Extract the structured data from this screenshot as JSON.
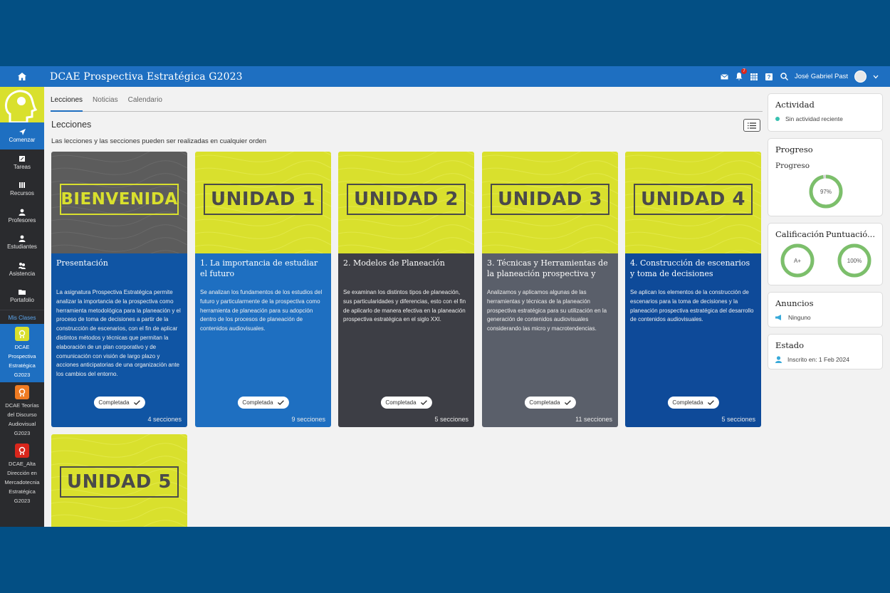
{
  "header": {
    "course_title": "DCAE Prospectiva Estratégica G2023",
    "user_name": "José Gabriel Past",
    "notification_count": "7"
  },
  "sidebar": {
    "items": [
      {
        "label": "Comenzar",
        "icon": "arrow-icon",
        "active": true
      },
      {
        "label": "Tareas",
        "icon": "edit-icon",
        "active": false
      },
      {
        "label": "Recursos",
        "icon": "library-icon",
        "active": false
      },
      {
        "label": "Profesores",
        "icon": "user-icon",
        "active": false
      },
      {
        "label": "Estudiantes",
        "icon": "user-icon",
        "active": false
      },
      {
        "label": "Asistencia",
        "icon": "group-icon",
        "active": false
      },
      {
        "label": "Portafolio",
        "icon": "folder-icon",
        "active": false
      }
    ],
    "section_label": "Mis Clases",
    "courses": [
      {
        "label": "DCAE Prospectiva Estratégica G2023",
        "color": "#d9e02d",
        "active": true
      },
      {
        "label": "DCAE Teorías del Discurso Audiovisual G2023",
        "color": "#ef7b22",
        "active": false
      },
      {
        "label": "DCAE_Alta Dirección en Mercadotecnia Estratégica G2023",
        "color": "#d9261c",
        "active": false
      }
    ]
  },
  "tabs": [
    {
      "label": "Lecciones",
      "active": true
    },
    {
      "label": "Noticias",
      "active": false
    },
    {
      "label": "Calendario",
      "active": false
    }
  ],
  "lessons": {
    "title": "Lecciones",
    "subtitle": "Las lecciones y las secciones pueden ser realizadas en cualquier orden",
    "cards": [
      {
        "banner": "BIENVENIDA",
        "title": "Presentación",
        "desc": "La asignatura Prospectiva Estratégica permite analizar la importancia de la prospectiva como herramienta metodológica para la planeación y el proceso de toma de decisiones a partir de la construcción de escenarios, con el fin de aplicar distintos métodos y técnicas que permitan la elaboración de un plan corporativo y de comunicación con visión de largo plazo y acciones anticipatorias de una organización ante los cambios del entorno.",
        "status": "Completada",
        "count": "4 secciones",
        "color": "#1055a4"
      },
      {
        "banner": "UNIDAD 1",
        "title": "1. La importancia de estudiar el futuro",
        "desc": "Se analizan los fundamentos de los estudios del futuro y particularmente de la prospectiva como herramienta de planeación para su adopción dentro de los procesos de planeación de contenidos audiovisuales.",
        "status": "Completada",
        "count": "9 secciones",
        "color": "#1e6fc1"
      },
      {
        "banner": "UNIDAD 2",
        "title": "2. Modelos de Planeación",
        "desc": "Se examinan los distintos tipos de planeación, sus particularidades y diferencias, esto con el fin de aplicarlo de manera efectiva en la planeación prospectiva estratégica en el siglo XXI.",
        "status": "Completada",
        "count": "5 secciones",
        "color": "#3d3e45"
      },
      {
        "banner": "UNIDAD 3",
        "title": "3. Técnicas y Herramientas de la planeación prospectiva y",
        "desc": "Analizamos y aplicamos algunas de las herramientas y técnicas de la planeación prospectiva estratégica para su utilización en la generación de contenidos audiovisuales considerando las micro y macrotendencias.",
        "status": "Completada",
        "count": "11 secciones",
        "color": "#5a5f6a"
      },
      {
        "banner": "UNIDAD 4",
        "title": "4. Construcción de escenarios y toma de decisiones",
        "desc": "Se aplican los elementos de la construcción de escenarios para la toma de decisiones y la planeación prospectiva estratégica del desarrollo de contenidos audiovisuales.",
        "status": "Completada",
        "count": "5 secciones",
        "color": "#0e4a99"
      }
    ],
    "extra_card": {
      "banner": "UNIDAD 5"
    }
  },
  "rail": {
    "activity": {
      "title": "Actividad",
      "text": "Sin actividad reciente"
    },
    "progress": {
      "title": "Progreso",
      "label": "Progreso",
      "value": "97%",
      "fraction": 0.97
    },
    "grades": {
      "grade_title": "Calificación",
      "grade_value": "A+",
      "grade_fraction": 1.0,
      "score_title": "Puntuació...",
      "score_value": "100%",
      "score_fraction": 1.0
    },
    "announcements": {
      "title": "Anuncios",
      "text": "Ninguno"
    },
    "status": {
      "title": "Estado",
      "text": "Inscrito en: 1 Feb 2024"
    }
  },
  "colors": {
    "accent_blue": "#1e6fc1",
    "lime": "#d9e02d",
    "ring_green": "#7cbf6b"
  }
}
